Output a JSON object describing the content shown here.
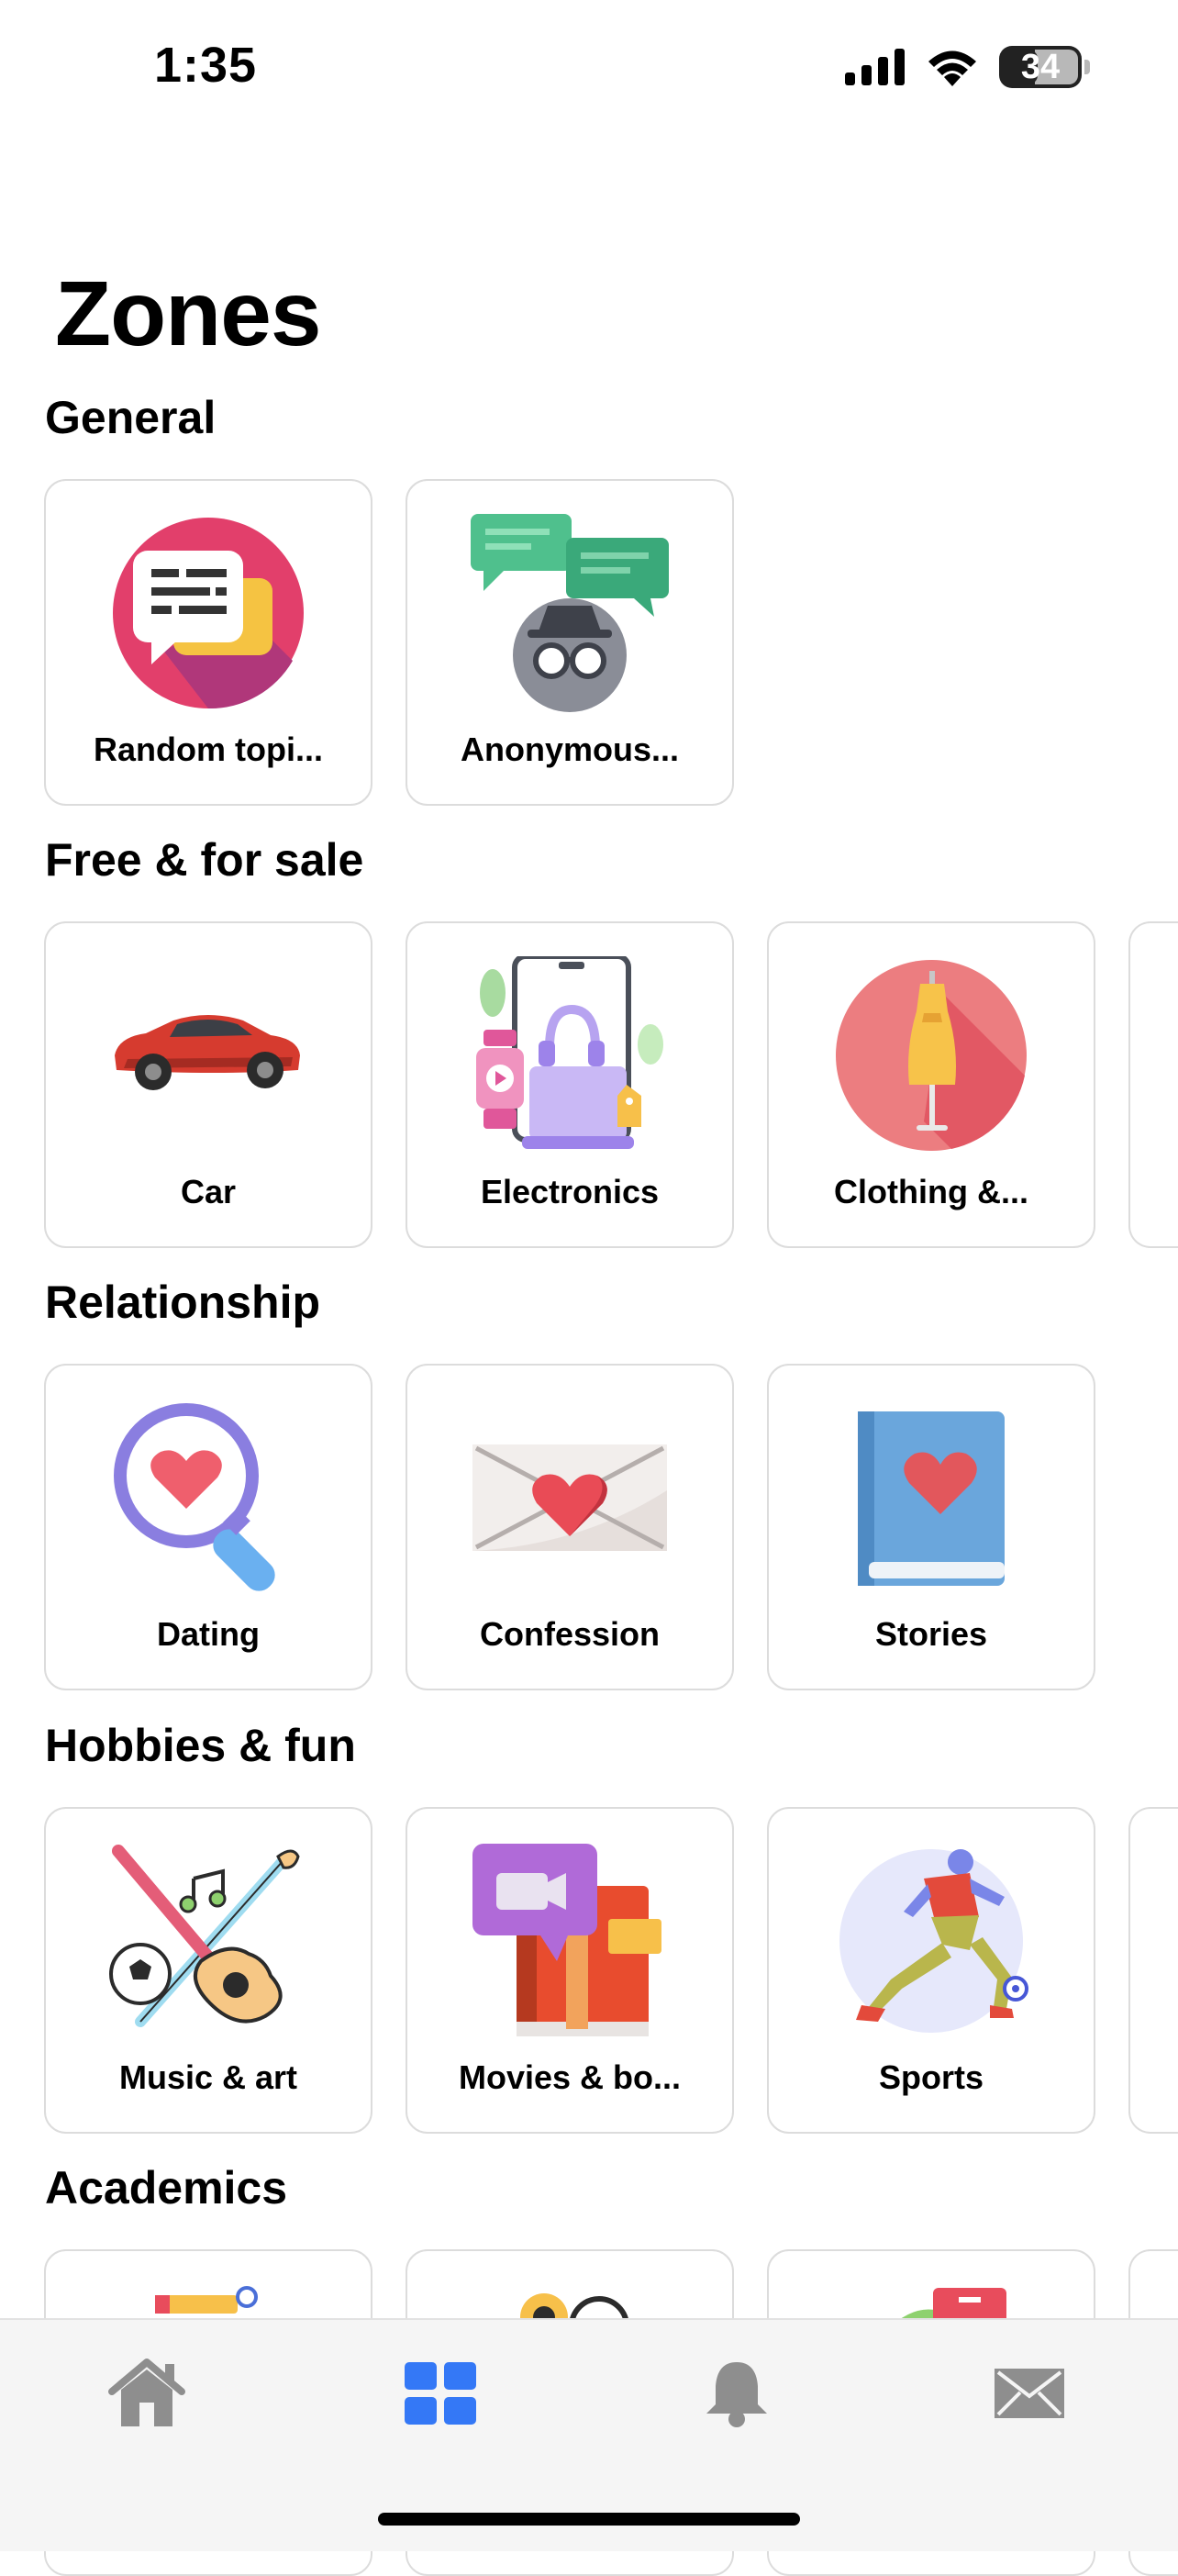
{
  "status": {
    "time": "1:35",
    "battery": "34"
  },
  "page": {
    "title": "Zones"
  },
  "sections": [
    {
      "title": "General",
      "cards": [
        {
          "label": "Random topi...",
          "icon": "random-topics-icon"
        },
        {
          "label": "Anonymous...",
          "icon": "anonymous-icon"
        }
      ]
    },
    {
      "title": "Free & for sale",
      "cards": [
        {
          "label": "Car",
          "icon": "car-icon"
        },
        {
          "label": "Electronics",
          "icon": "electronics-icon"
        },
        {
          "label": "Clothing &...",
          "icon": "clothing-icon"
        }
      ]
    },
    {
      "title": "Relationship",
      "cards": [
        {
          "label": "Dating",
          "icon": "dating-icon"
        },
        {
          "label": "Confession",
          "icon": "confession-icon"
        },
        {
          "label": "Stories",
          "icon": "stories-icon"
        }
      ]
    },
    {
      "title": "Hobbies & fun",
      "cards": [
        {
          "label": "Music & art",
          "icon": "music-art-icon"
        },
        {
          "label": "Movies & bo...",
          "icon": "movies-books-icon"
        },
        {
          "label": "Sports",
          "icon": "sports-icon"
        }
      ]
    },
    {
      "title": "Academics",
      "cards": []
    }
  ],
  "tabs": [
    {
      "name": "home",
      "icon": "home-icon",
      "active": false
    },
    {
      "name": "zones",
      "icon": "grid-icon",
      "active": true
    },
    {
      "name": "notifications",
      "icon": "bell-icon",
      "active": false
    },
    {
      "name": "messages",
      "icon": "mail-icon",
      "active": false
    }
  ],
  "colors": {
    "accent": "#3478f6",
    "tab_inactive": "#8e8e8e",
    "card_border": "#dcdcdc"
  }
}
